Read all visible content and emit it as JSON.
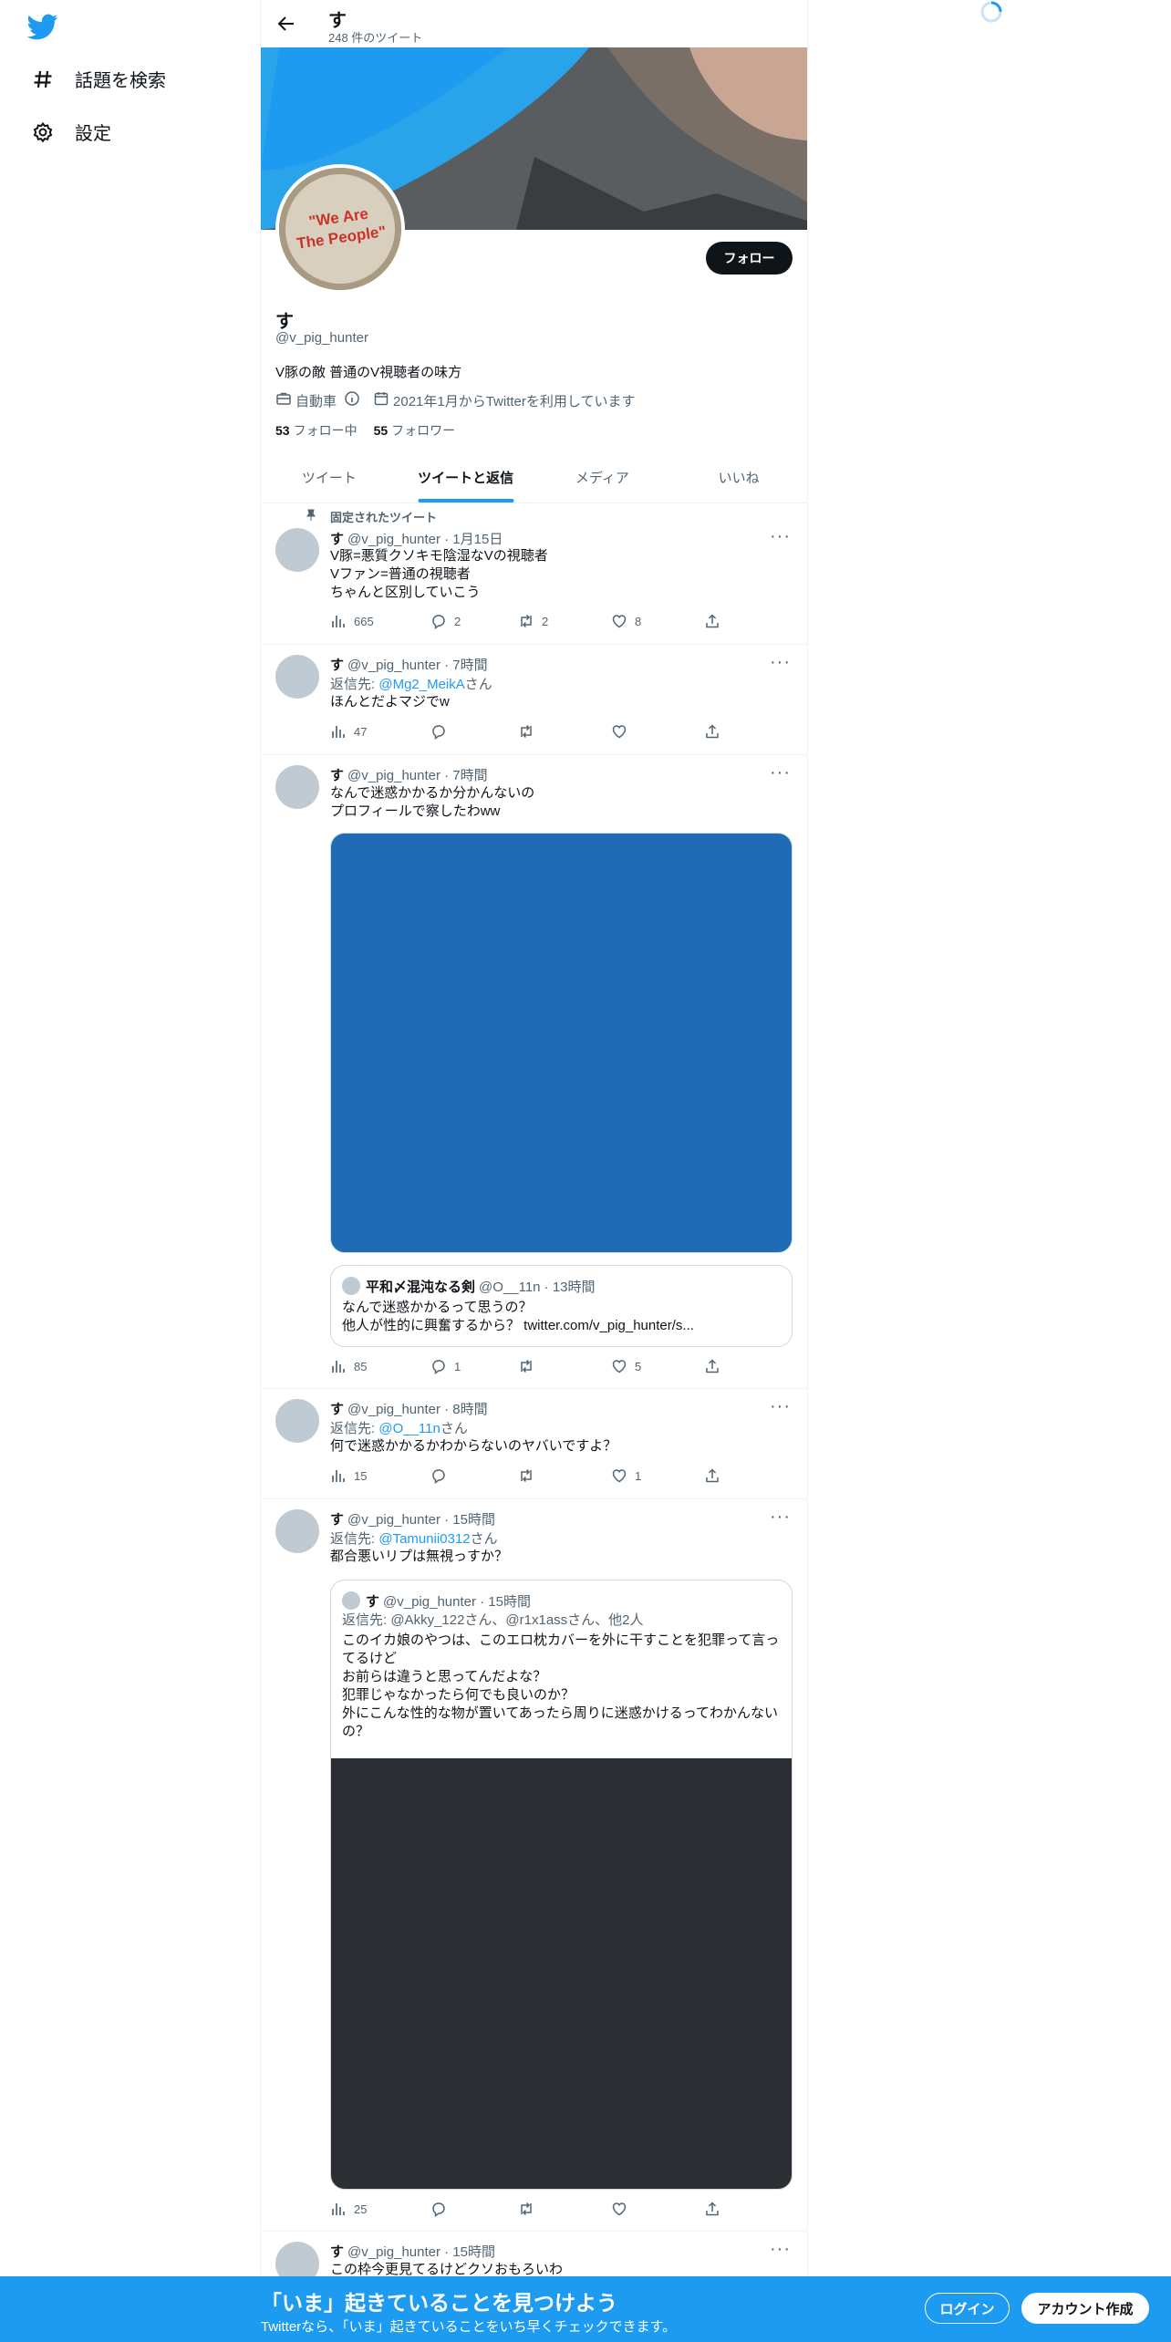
{
  "nav": {
    "explore_label": "話題を検索",
    "settings_label": "設定"
  },
  "header": {
    "title": "す",
    "tweet_count": "248 件のツイート"
  },
  "profile": {
    "avatar_text": "\"We Are The People\"",
    "follow_label": "フォロー",
    "name": "す",
    "handle": "@v_pig_hunter",
    "bio": "V豚の敵 普通のV視聴者の味方",
    "category": "自動車",
    "joined": "2021年1月からTwitterを利用しています",
    "following_count": "53",
    "following_label": "フォロー中",
    "followers_count": "55",
    "followers_label": "フォロワー"
  },
  "tabs": [
    "ツイート",
    "ツイートと返信",
    "メディア",
    "いいね"
  ],
  "tweets": [
    {
      "pinned_label": "固定されたツイート",
      "name": "す",
      "meta": "@v_pig_hunter · 1月15日",
      "text": "V豚=悪質クソキモ陰湿なVの視聴者\nVファン=普通の視聴者\nちゃんと区別していこう",
      "views": "665",
      "replies": "2",
      "retweets": "2",
      "likes": "8"
    },
    {
      "name": "す",
      "meta": "@v_pig_hunter · 7時間",
      "reply_prefix": "返信先: ",
      "reply_to": "@Mg2_MeikA",
      "reply_suffix": "さん",
      "text": "ほんとだよマジでw",
      "views": "47",
      "replies": "",
      "retweets": "",
      "likes": ""
    },
    {
      "name": "す",
      "meta": "@v_pig_hunter · 7時間",
      "text": "なんで迷惑かかるか分かんないの\nプロフィールで察したわww",
      "quote_name": "平和〆混沌なる剣",
      "quote_meta": "@O__11n · 13時間",
      "quote_text": "なんで迷惑かかるって思うの？\n他人が性的に興奮するから？ twitter.com/v_pig_hunter/s...",
      "views": "85",
      "replies": "1",
      "retweets": "",
      "likes": "5"
    },
    {
      "name": "す",
      "meta": "@v_pig_hunter · 8時間",
      "reply_prefix": "返信先: ",
      "reply_to": "@O__11n",
      "reply_suffix": "さん",
      "text": "何で迷惑かかるかわからないのヤバいですよ？",
      "views": "15",
      "replies": "",
      "retweets": "",
      "likes": "1"
    },
    {
      "name": "す",
      "meta": "@v_pig_hunter · 15時間",
      "reply_prefix": "返信先: ",
      "reply_to": "@Tamunii0312",
      "reply_suffix": "さん",
      "text": "都合悪いリプは無視っすか？",
      "quote_name": "す",
      "quote_meta": "@v_pig_hunter · 15時間",
      "quote_reply": "返信先: @Akky_122さん、@r1x1assさん、他2人",
      "quote_text": "このイカ娘のやつは、このエロ枕カバーを外に干すことを犯罪って言ってるけど\nお前らは違うと思ってんだよな？\n犯罪じゃなかったら何でも良いのか？\n外にこんな性的な物が置いてあったら周りに迷惑かけるってわかんないの？",
      "views": "25",
      "replies": "",
      "retweets": "",
      "likes": ""
    },
    {
      "name": "す",
      "meta": "@v_pig_hunter · 15時間",
      "text": "この枠今更見てるけどクソおもろいわ"
    }
  ],
  "bottom_bar": {
    "title": "「いま」起きていることを見つけよう",
    "subtitle": "Twitterなら、「いま」起きていることをいち早くチェックできます。",
    "login_label": "ログイン",
    "signup_label": "アカウント作成"
  },
  "colors": {
    "accent": "#1d9bf0",
    "media_blue": "#1f6bb5",
    "media_dark": "#2b2f33"
  },
  "icons": [
    "twitter-logo-icon",
    "hashtag-icon",
    "gear-icon",
    "back-arrow-icon",
    "briefcase-icon",
    "info-icon",
    "calendar-icon",
    "pin-icon",
    "more-icon",
    "views-icon",
    "reply-icon",
    "retweet-icon",
    "like-icon",
    "share-icon",
    "loading-spinner-icon"
  ]
}
